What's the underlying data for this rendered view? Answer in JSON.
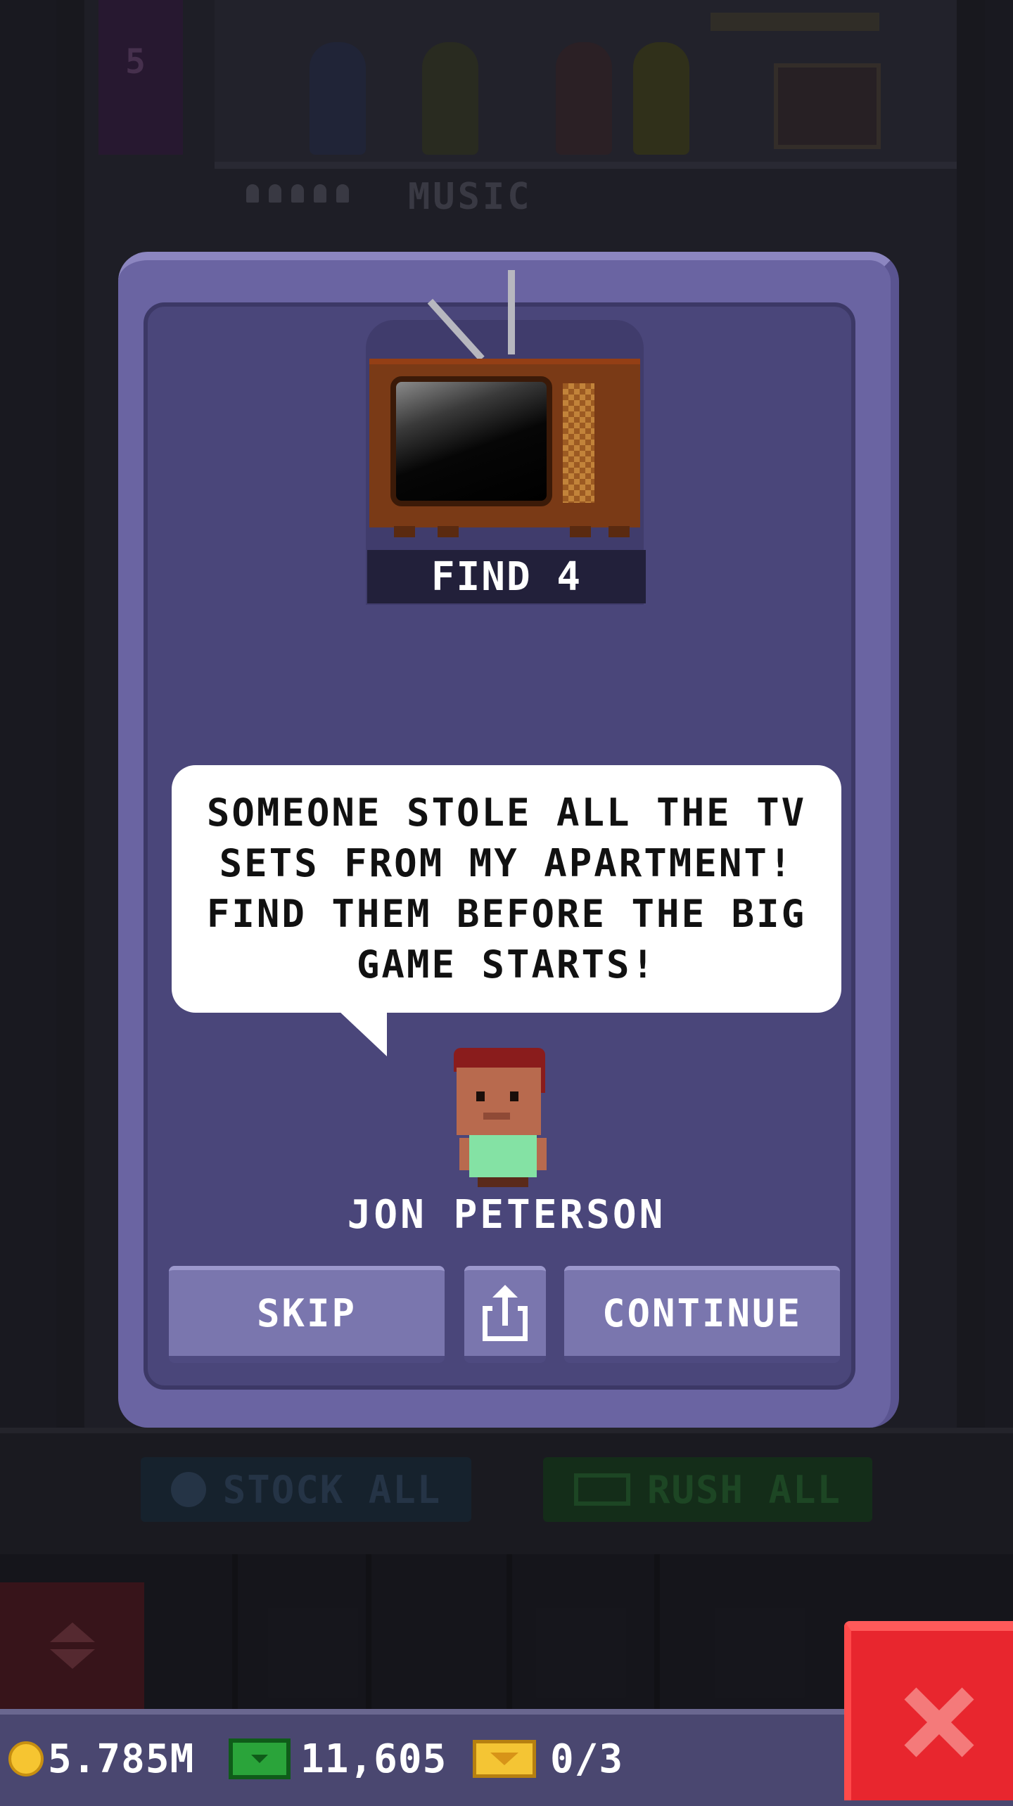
{
  "background": {
    "floor_label": "MUSIC",
    "elevator_floor_number": "5",
    "stock_all_label": "STOCK ALL",
    "rush_all_label": "RUSH ALL"
  },
  "mission": {
    "find_label": "FIND 4",
    "message": "SOMEONE STOLE ALL THE TV\nSETS FROM MY APARTMENT!\nFIND THEM BEFORE THE BIG\nGAME STARTS!",
    "character_name": "JON PETERSON",
    "skip_label": "SKIP",
    "continue_label": "CONTINUE"
  },
  "status": {
    "coins": "5.785M",
    "bux": "11,605",
    "tickets": "0/3"
  },
  "colors": {
    "dialog": "#6a64a2",
    "dialog_inner": "#4a467a",
    "close_button": "#e8262e",
    "status_bar": "#4a4770"
  },
  "icons": {
    "tv": "tv-icon",
    "share": "share-icon",
    "close": "close-icon",
    "coin": "coin-icon",
    "bux": "bux-icon",
    "ticket": "ticket-icon"
  }
}
